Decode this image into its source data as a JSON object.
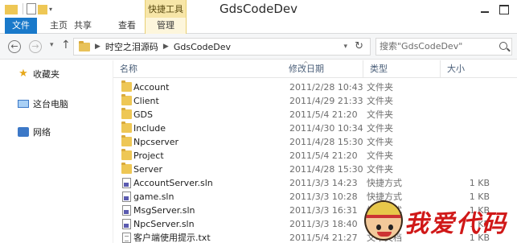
{
  "window": {
    "title": "GdsCodeDev",
    "context_tab_label": "快捷工具"
  },
  "ribbon": {
    "tabs": [
      {
        "label": "文件"
      },
      {
        "label": "主页"
      },
      {
        "label": "共享"
      },
      {
        "label": "查看"
      },
      {
        "label": "管理"
      }
    ]
  },
  "address": {
    "crumbs": [
      "时空之泪源码",
      "GdsCodeDev"
    ],
    "search_placeholder": "搜索\"GdsCodeDev\""
  },
  "sidebar": {
    "items": [
      {
        "label": "收藏夹",
        "icon": "star-icon"
      },
      {
        "label": "这台电脑",
        "icon": "computer-icon"
      },
      {
        "label": "网络",
        "icon": "network-icon"
      }
    ]
  },
  "list": {
    "columns": [
      "名称",
      "修改日期",
      "类型",
      "大小"
    ],
    "rows": [
      {
        "name": "Account",
        "date": "2011/2/28 10:43",
        "type": "文件夹",
        "size": "",
        "icon": "folder"
      },
      {
        "name": "Client",
        "date": "2011/4/29 21:33",
        "type": "文件夹",
        "size": "",
        "icon": "folder"
      },
      {
        "name": "GDS",
        "date": "2011/5/4 21:20",
        "type": "文件夹",
        "size": "",
        "icon": "folder"
      },
      {
        "name": "Include",
        "date": "2011/4/30 10:34",
        "type": "文件夹",
        "size": "",
        "icon": "folder"
      },
      {
        "name": "Npcserver",
        "date": "2011/4/28 15:30",
        "type": "文件夹",
        "size": "",
        "icon": "folder"
      },
      {
        "name": "Project",
        "date": "2011/5/4 21:20",
        "type": "文件夹",
        "size": "",
        "icon": "folder"
      },
      {
        "name": "Server",
        "date": "2011/4/28 15:30",
        "type": "文件夹",
        "size": "",
        "icon": "folder"
      },
      {
        "name": "AccountServer.sln",
        "date": "2011/3/3 14:23",
        "type": "快捷方式",
        "size": "1 KB",
        "icon": "sln"
      },
      {
        "name": "game.sln",
        "date": "2011/3/3 10:28",
        "type": "快捷方式",
        "size": "1 KB",
        "icon": "sln"
      },
      {
        "name": "MsgServer.sln",
        "date": "2011/3/3 16:31",
        "type": "快捷方式",
        "size": "1 KB",
        "icon": "sln"
      },
      {
        "name": "NpcServer.sln",
        "date": "2011/3/3 18:40",
        "type": "快捷方式",
        "size": "1 KB",
        "icon": "sln"
      },
      {
        "name": "客户端使用提示.txt",
        "date": "2011/5/4 21:27",
        "type": "文本文档",
        "size": "1 KB",
        "icon": "txt"
      }
    ]
  },
  "watermark": {
    "text": "我爱代码"
  },
  "colors": {
    "file_tab": "#1979ca",
    "context_tab": "#f7e6a8",
    "folder": "#eec755",
    "watermark_text": "#d01818"
  }
}
